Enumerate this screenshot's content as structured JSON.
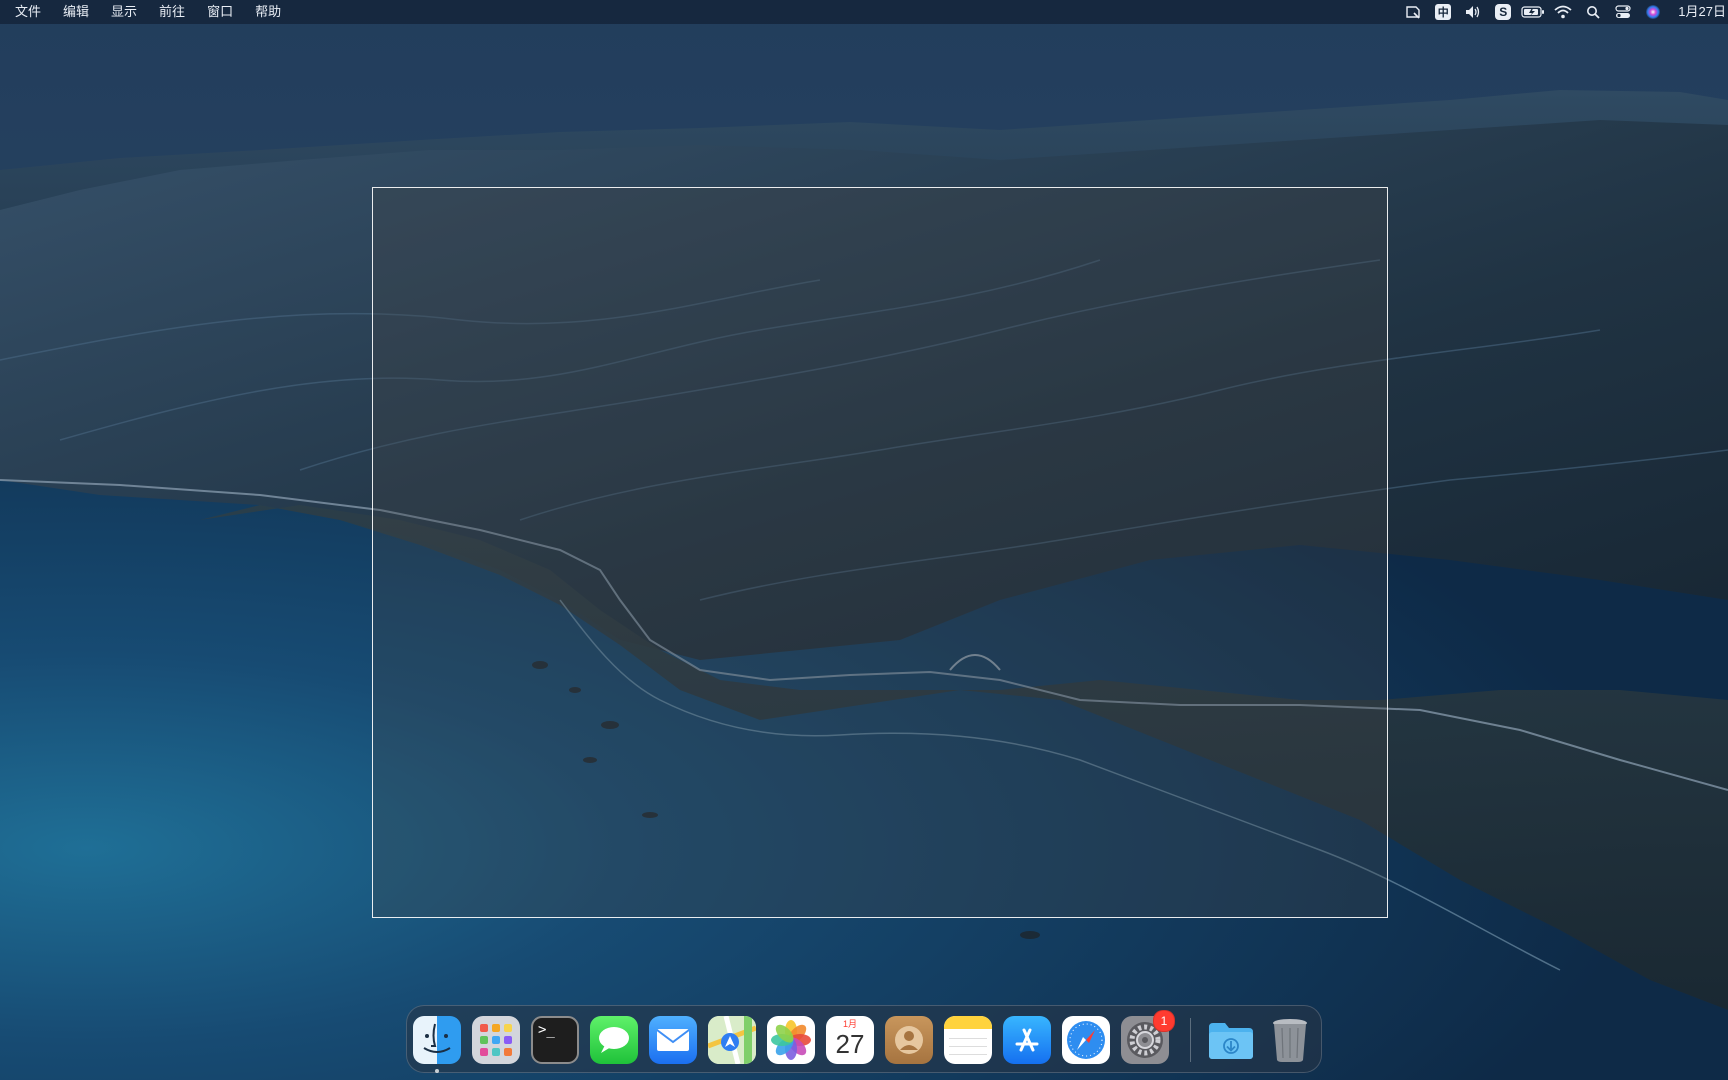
{
  "menubar": {
    "items": [
      {
        "label": "文件"
      },
      {
        "label": "编辑"
      },
      {
        "label": "显示"
      },
      {
        "label": "前往"
      },
      {
        "label": "窗口"
      },
      {
        "label": "帮助"
      }
    ],
    "status_icons": [
      "screenshot-tool-icon",
      "input-method-icon",
      "volume-icon",
      "s-app-icon",
      "battery-charging-icon",
      "wifi-icon",
      "spotlight-search-icon",
      "control-center-icon",
      "siri-icon"
    ],
    "input_method_label": "中",
    "clock": "1月27日"
  },
  "dock": {
    "apps": [
      {
        "name": "Finder",
        "icon": "finder-icon"
      },
      {
        "name": "Launchpad",
        "icon": "launchpad-icon"
      },
      {
        "name": "Terminal",
        "icon": "terminal-icon",
        "glyph": ">_"
      },
      {
        "name": "Messages",
        "icon": "messages-icon"
      },
      {
        "name": "Mail",
        "icon": "mail-icon"
      },
      {
        "name": "Maps",
        "icon": "maps-icon"
      },
      {
        "name": "Photos",
        "icon": "photos-icon"
      },
      {
        "name": "Calendar",
        "icon": "calendar-icon",
        "month": "1月",
        "day": "27"
      },
      {
        "name": "Contacts",
        "icon": "contacts-icon"
      },
      {
        "name": "Notes",
        "icon": "notes-icon"
      },
      {
        "name": "App Store",
        "icon": "app-store-icon"
      },
      {
        "name": "Safari",
        "icon": "safari-icon"
      },
      {
        "name": "System Preferences",
        "icon": "system-preferences-icon",
        "badge": "1"
      },
      {
        "name": "Downloads",
        "icon": "downloads-folder-icon"
      },
      {
        "name": "Trash",
        "icon": "trash-icon"
      }
    ]
  },
  "colors": {
    "sky": "#1d3550",
    "sea": "#163a5c",
    "mountain": "#233a4f",
    "badge": "#ff3b30"
  }
}
